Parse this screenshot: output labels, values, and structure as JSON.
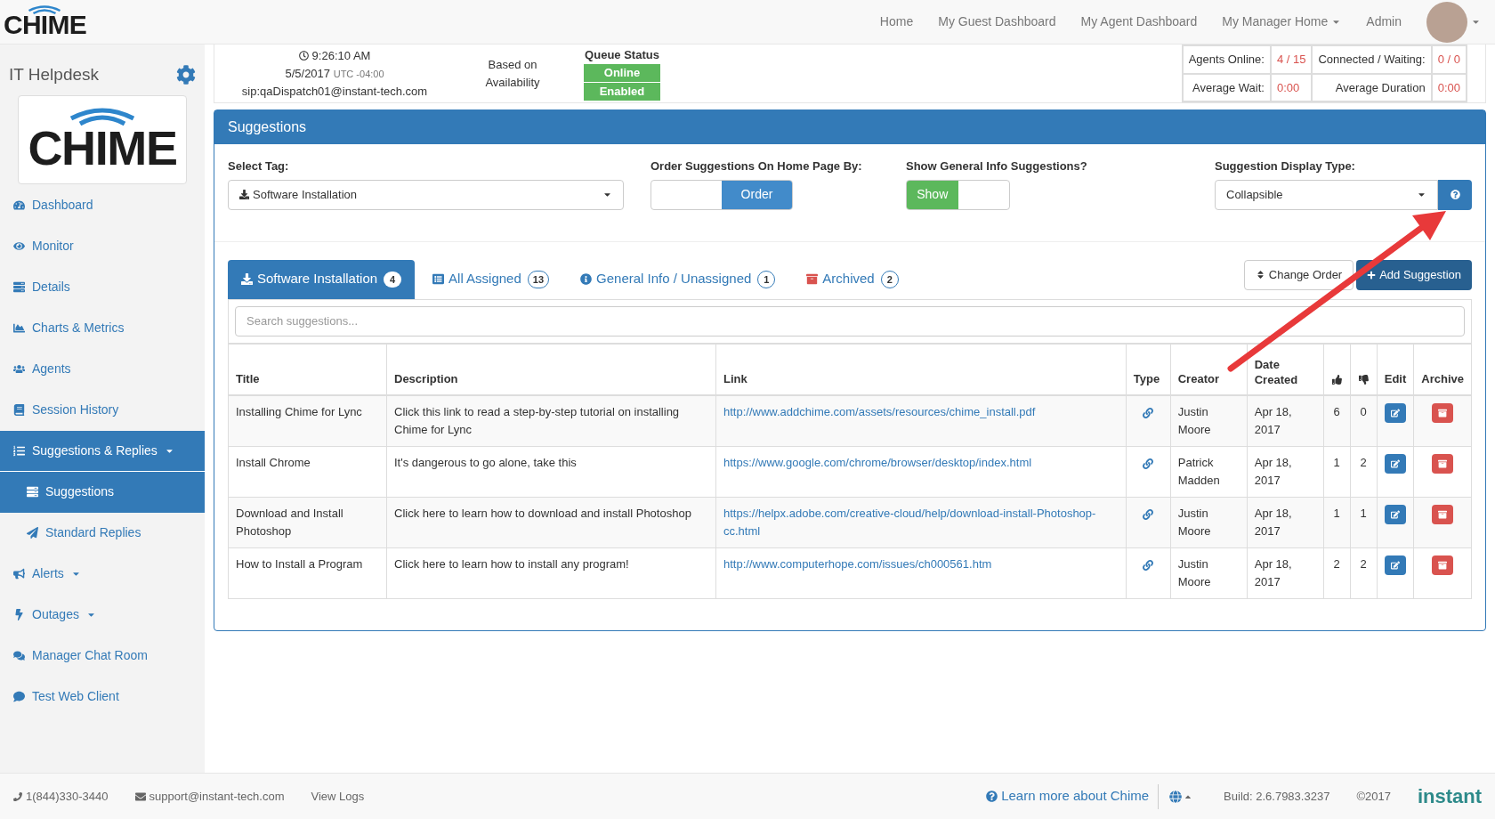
{
  "topnav": {
    "logo": "CHIME",
    "links": [
      {
        "label": "Home",
        "dropdown": false
      },
      {
        "label": "My Guest Dashboard",
        "dropdown": false
      },
      {
        "label": "My Agent Dashboard",
        "dropdown": false
      },
      {
        "label": "My Manager Home",
        "dropdown": true
      },
      {
        "label": "Admin",
        "dropdown": false
      }
    ]
  },
  "sidebar": {
    "title": "IT Helpdesk",
    "logo": "CHIME",
    "items": [
      {
        "label": "Dashboard",
        "selected": false,
        "dropdown": false
      },
      {
        "label": "Monitor",
        "selected": false,
        "dropdown": false
      },
      {
        "label": "Details",
        "selected": false,
        "dropdown": false
      },
      {
        "label": "Charts & Metrics",
        "selected": false,
        "dropdown": false
      },
      {
        "label": "Agents",
        "selected": false,
        "dropdown": false
      },
      {
        "label": "Session History",
        "selected": false,
        "dropdown": false
      },
      {
        "label": "Suggestions & Replies",
        "selected": true,
        "dropdown": true,
        "children": [
          {
            "label": "Suggestions",
            "selected": true
          },
          {
            "label": "Standard Replies",
            "selected": false
          }
        ]
      },
      {
        "label": "Alerts",
        "selected": false,
        "dropdown": true
      },
      {
        "label": "Outages",
        "selected": false,
        "dropdown": true
      },
      {
        "label": "Manager Chat Room",
        "selected": false,
        "dropdown": false
      },
      {
        "label": "Test Web Client",
        "selected": false,
        "dropdown": false
      }
    ]
  },
  "status": {
    "time": "9:26:10 AM",
    "date": "5/5/2017",
    "tz": "UTC -04:00",
    "sip": "sip:qaDispatch01@instant-tech.com",
    "availability": "Based on Availability",
    "queue_title": "Queue Status",
    "queue_badges": [
      "Online",
      "Enabled"
    ],
    "stats": [
      {
        "label": "Agents Online:",
        "value": "4 / 15"
      },
      {
        "label": "Connected / Waiting:",
        "value": "0 / 0"
      },
      {
        "label": "Average Wait:",
        "value": "0:00"
      },
      {
        "label": "Average Duration",
        "value": "0:00"
      }
    ]
  },
  "panel": {
    "title": "Suggestions",
    "select_tag": {
      "label": "Select Tag:",
      "value": "Software Installation"
    },
    "order": {
      "label": "Order Suggestions On Home Page By:",
      "button": "Order",
      "on": true
    },
    "general_info": {
      "label": "Show General Info Suggestions?",
      "button": "Show",
      "on": true
    },
    "display_type": {
      "label": "Suggestion Display Type:",
      "value": "Collapsible"
    },
    "tabs": [
      {
        "label": "Software Installation",
        "count": "4",
        "selected": true
      },
      {
        "label": "All Assigned",
        "count": "13",
        "selected": false
      },
      {
        "label": "General Info / Unassigned",
        "count": "1",
        "selected": false
      },
      {
        "label": "Archived",
        "count": "2",
        "selected": false
      }
    ],
    "change_order": "Change Order",
    "add_suggestion": "Add Suggestion",
    "search": {
      "placeholder": "Search suggestions..."
    },
    "table": {
      "columns": [
        "Title",
        "Description",
        "Link",
        "Type",
        "Creator",
        "Date Created",
        "Edit",
        "Archive"
      ],
      "rows": [
        {
          "title": "Installing Chime for Lync",
          "description": "Click this link to read a step-by-step tutorial on installing Chime for Lync",
          "link": "http://www.addchime.com/assets/resources/chime_install.pdf",
          "creator": "Justin Moore",
          "date": "Apr 18, 2017",
          "up": "6",
          "down": "0"
        },
        {
          "title": "Install Chrome",
          "description": "It's dangerous to go alone, take this",
          "link": "https://www.google.com/chrome/browser/desktop/index.html",
          "creator": "Patrick Madden",
          "date": "Apr 18, 2017",
          "up": "1",
          "down": "2"
        },
        {
          "title": "Download and Install Photoshop",
          "description": "Click here to learn how to download and install Photoshop",
          "link": "https://helpx.adobe.com/creative-cloud/help/download-install-Photoshop-cc.html",
          "creator": "Justin Moore",
          "date": "Apr 18, 2017",
          "up": "1",
          "down": "1"
        },
        {
          "title": "How to Install a Program",
          "description": "Click here to learn how to install any program!",
          "link": "http://www.computerhope.com/issues/ch000561.htm",
          "creator": "Justin Moore",
          "date": "Apr 18, 2017",
          "up": "2",
          "down": "2"
        }
      ]
    }
  },
  "footer": {
    "phone": "1(844)330-3440",
    "email": "support@instant-tech.com",
    "view_logs": "View Logs",
    "learn_more": "Learn more about Chime",
    "build": "Build: 2.6.7983.3237",
    "copyright": "©2017",
    "brand": "instant"
  }
}
